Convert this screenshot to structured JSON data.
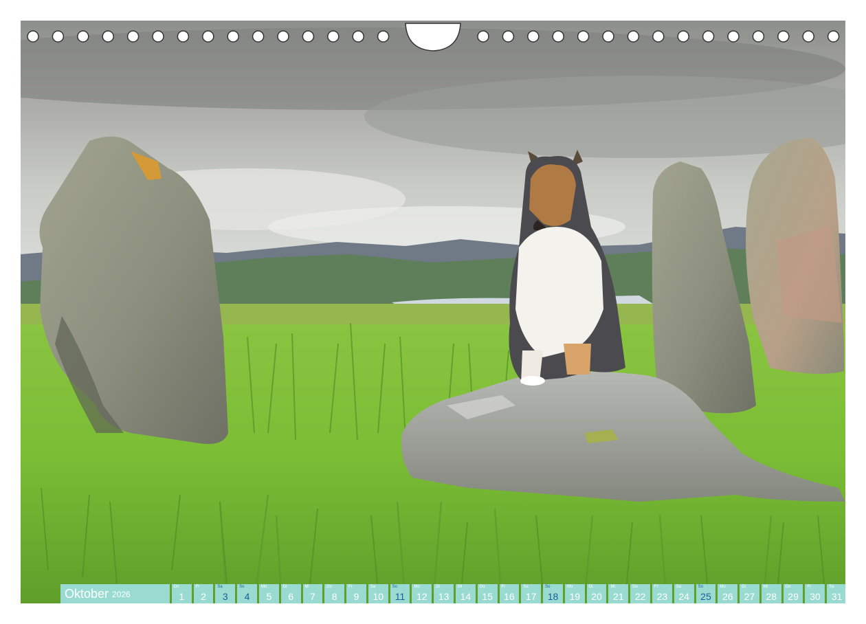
{
  "calendar": {
    "month": "Oktober",
    "year": "2026",
    "days": [
      {
        "wd": "Do",
        "n": "1"
      },
      {
        "wd": "Fr",
        "n": "2"
      },
      {
        "wd": "Sa",
        "n": "3"
      },
      {
        "wd": "So",
        "n": "4"
      },
      {
        "wd": "Mo",
        "n": "5"
      },
      {
        "wd": "Di",
        "n": "6"
      },
      {
        "wd": "Mi",
        "n": "7"
      },
      {
        "wd": "Do",
        "n": "8"
      },
      {
        "wd": "Fr",
        "n": "9"
      },
      {
        "wd": "Sa",
        "n": "10"
      },
      {
        "wd": "So",
        "n": "11"
      },
      {
        "wd": "Mo",
        "n": "12"
      },
      {
        "wd": "Di",
        "n": "13"
      },
      {
        "wd": "Mi",
        "n": "14"
      },
      {
        "wd": "Do",
        "n": "15"
      },
      {
        "wd": "Fr",
        "n": "16"
      },
      {
        "wd": "Sa",
        "n": "17"
      },
      {
        "wd": "So",
        "n": "18"
      },
      {
        "wd": "Mo",
        "n": "19"
      },
      {
        "wd": "Di",
        "n": "20"
      },
      {
        "wd": "Mi",
        "n": "21"
      },
      {
        "wd": "Do",
        "n": "22"
      },
      {
        "wd": "Fr",
        "n": "23"
      },
      {
        "wd": "Sa",
        "n": "24"
      },
      {
        "wd": "So",
        "n": "25"
      },
      {
        "wd": "Mo",
        "n": "26"
      },
      {
        "wd": "Di",
        "n": "27"
      },
      {
        "wd": "Mi",
        "n": "28"
      },
      {
        "wd": "Do",
        "n": "29"
      },
      {
        "wd": "Fr",
        "n": "30"
      },
      {
        "wd": "Sa",
        "n": "31"
      }
    ],
    "highlighted_days": [
      "3",
      "4",
      "11",
      "18",
      "25"
    ]
  },
  "colors": {
    "bar": "#a0e2e8",
    "weekend_text": "#1a5f9a",
    "sky": "#b8bab5",
    "grass": "#7cc23a"
  },
  "icons": {
    "binding": "spiral-binding-rings",
    "hanger": "hanging-notch"
  }
}
